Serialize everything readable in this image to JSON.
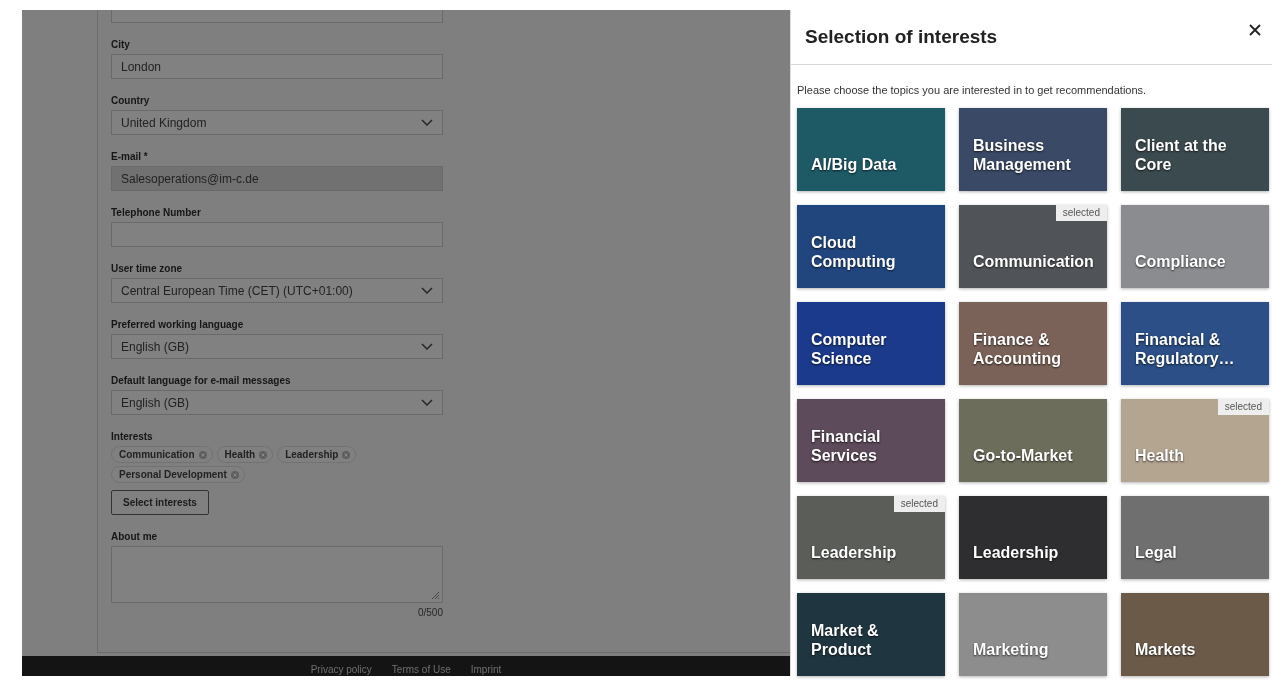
{
  "profile_form": {
    "fields": [
      {
        "kind": "text"
      },
      {
        "kind": "text",
        "label": "City",
        "value": "London"
      },
      {
        "kind": "select",
        "label": "Country",
        "value": "United Kingdom"
      },
      {
        "kind": "readonly",
        "label": "E-mail *",
        "value": "Salesoperations@im-c.de"
      },
      {
        "kind": "text",
        "label": "Telephone Number"
      },
      {
        "kind": "select",
        "label": "User time zone",
        "value": "Central European Time (CET) (UTC+01:00)"
      },
      {
        "kind": "select",
        "label": "Preferred working language",
        "value": "English (GB)"
      },
      {
        "kind": "select",
        "label": "Default language for e-mail messages",
        "value": "English (GB)"
      }
    ],
    "interests": {
      "label": "Interests",
      "chips": [
        "Communication",
        "Health",
        "Leadership",
        "Personal Development"
      ],
      "button": "Select interests"
    },
    "about": {
      "label": "About me",
      "counter": "0/500"
    }
  },
  "footer": {
    "links": [
      "Privacy policy",
      "Terms of Use",
      "Imprint"
    ]
  },
  "drawer": {
    "title": "Selection of interests",
    "description": "Please choose the topics you are interested in to get recommendations.",
    "tiles": [
      {
        "label": "AI/Big Data",
        "selected": false,
        "color": "#1d5a66"
      },
      {
        "label": "Business Management",
        "selected": false,
        "color": "#3a4a66"
      },
      {
        "label": "Client at the Core",
        "selected": false,
        "color": "#3b4a4e"
      },
      {
        "label": "Cloud Computing",
        "selected": false,
        "color": "#21467e"
      },
      {
        "label": "Communication",
        "selected": true,
        "badge": "selected",
        "color": "#505357"
      },
      {
        "label": "Compliance",
        "selected": false,
        "color": "#8a8c90"
      },
      {
        "label": "Computer Science",
        "selected": false,
        "color": "#1b3a8c"
      },
      {
        "label": "Finance & Accounting",
        "selected": false,
        "color": "#7a6258"
      },
      {
        "label": "Financial & Regulatory…",
        "selected": false,
        "color": "#2b4f86"
      },
      {
        "label": "Financial Services",
        "selected": false,
        "color": "#5d4a5a"
      },
      {
        "label": "Go-to-Market",
        "selected": false,
        "color": "#6d6d5c"
      },
      {
        "label": "Health",
        "selected": true,
        "badge": "selected",
        "color": "#b4a591"
      },
      {
        "label": "Leadership",
        "selected": true,
        "badge": "selected",
        "color": "#5b5e58"
      },
      {
        "label": "Leadership",
        "selected": false,
        "color": "#2e2e30"
      },
      {
        "label": "Legal",
        "selected": false,
        "color": "#6f6f6f"
      },
      {
        "label": "Market & Product",
        "selected": false,
        "color": "#1f3640"
      },
      {
        "label": "Marketing",
        "selected": false,
        "color": "#8d8d8d"
      },
      {
        "label": "Markets",
        "selected": false,
        "color": "#6b5a48"
      }
    ]
  }
}
